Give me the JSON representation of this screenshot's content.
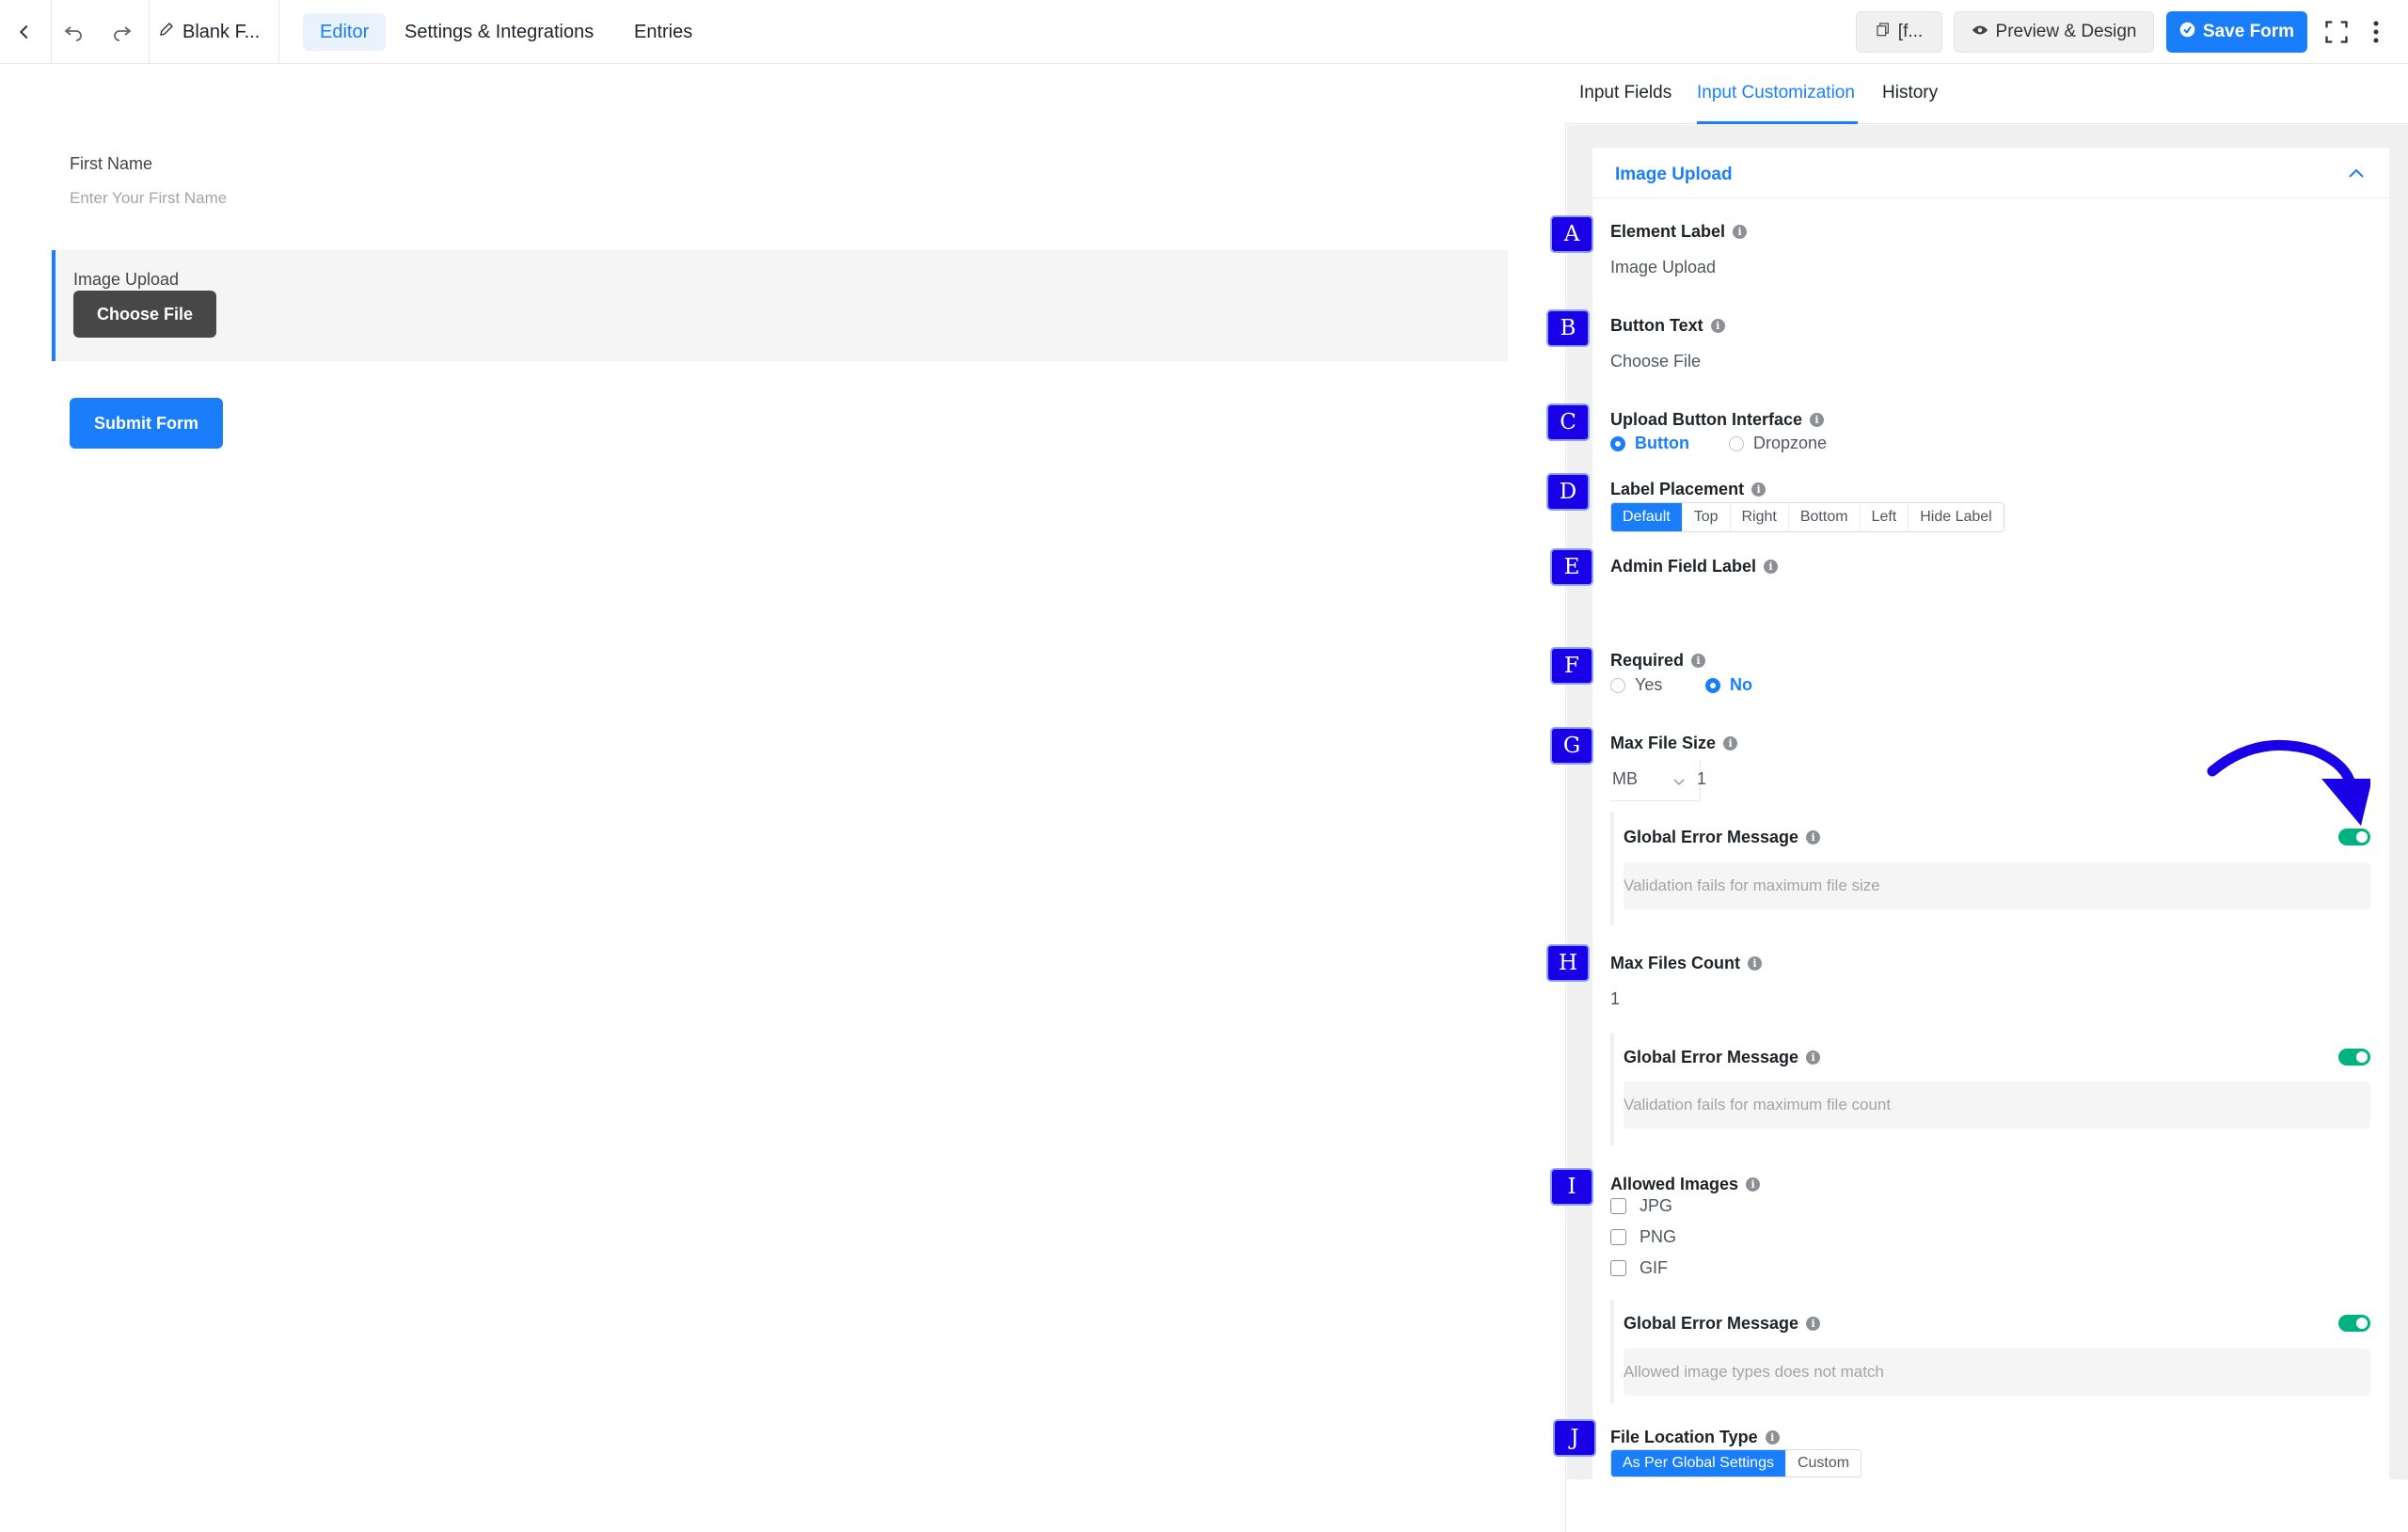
{
  "topbar": {
    "form_name": "Blank F...",
    "tabs": [
      "Editor",
      "Settings & Integrations",
      "Entries"
    ],
    "shortcode_btn": "[f...",
    "preview_btn": "Preview & Design",
    "save_btn": "Save Form"
  },
  "canvas": {
    "first_name_label": "First Name",
    "first_name_placeholder": "Enter Your First Name",
    "upload_label": "Image Upload",
    "choose_file": "Choose File",
    "submit": "Submit Form"
  },
  "panel": {
    "tabs": [
      "Input Fields",
      "Input Customization",
      "History"
    ],
    "section_title": "Image Upload",
    "badges": [
      "A",
      "B",
      "C",
      "D",
      "E",
      "F",
      "G",
      "H",
      "I",
      "J"
    ],
    "element_label": {
      "label": "Element Label",
      "value": "Image Upload"
    },
    "button_text": {
      "label": "Button Text",
      "value": "Choose File"
    },
    "upload_interface": {
      "label": "Upload Button Interface",
      "options": [
        "Button",
        "Dropzone"
      ],
      "selected": "Button"
    },
    "label_placement": {
      "label": "Label Placement",
      "options": [
        "Default",
        "Top",
        "Right",
        "Bottom",
        "Left",
        "Hide Label"
      ],
      "selected": "Default"
    },
    "admin_label": {
      "label": "Admin Field Label"
    },
    "required": {
      "label": "Required",
      "options": [
        "Yes",
        "No"
      ],
      "selected": "No"
    },
    "max_file_size": {
      "label": "Max File Size",
      "unit": "MB",
      "value": "1"
    },
    "max_size_error": {
      "label": "Global Error Message",
      "placeholder": "Validation fails for maximum file size",
      "enabled": true
    },
    "max_files_count": {
      "label": "Max Files Count",
      "value": "1"
    },
    "max_count_error": {
      "label": "Global Error Message",
      "placeholder": "Validation fails for maximum file count",
      "enabled": true
    },
    "allowed_images": {
      "label": "Allowed Images",
      "options": [
        "JPG",
        "PNG",
        "GIF"
      ]
    },
    "allowed_error": {
      "label": "Global Error Message",
      "placeholder": "Allowed image types does not match",
      "enabled": true
    },
    "file_location": {
      "label": "File Location Type",
      "options": [
        "As Per Global Settings",
        "Custom"
      ],
      "selected": "As Per Global Settings"
    }
  },
  "colors": {
    "accent": "#1a7efb",
    "badge": "#1a00e6",
    "toggle_on": "#00b27f",
    "arrow": "#1a00e6"
  }
}
